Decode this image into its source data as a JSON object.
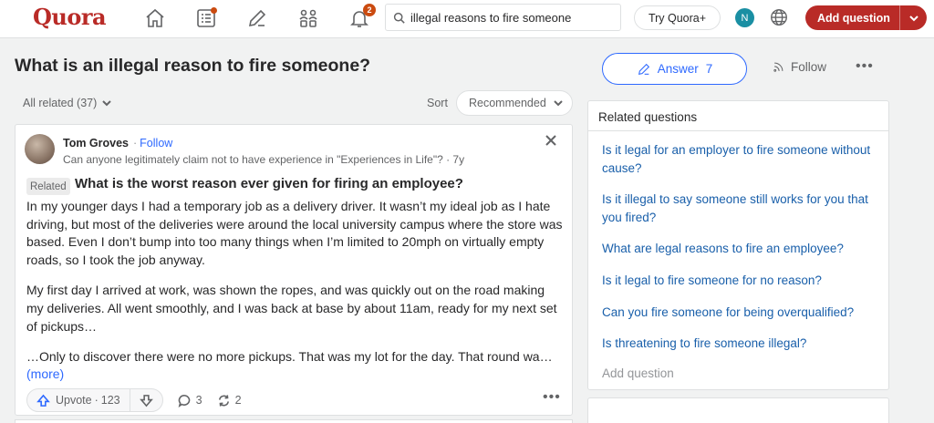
{
  "nav": {
    "logo": "Quora",
    "notifications_count": "2",
    "search_value": "illegal reasons to fire someone",
    "try_plus_label": "Try Quora+",
    "avatar_initial": "N",
    "add_question_label": "Add question",
    "icons": [
      "home-icon",
      "following-icon",
      "answer-icon",
      "spaces-icon",
      "notifications-icon",
      "search-icon",
      "globe-icon",
      "chevron-down-icon"
    ]
  },
  "question": {
    "title": "What is an illegal reason to fire someone?",
    "answer_label": "Answer",
    "answer_count": "7",
    "follow_label": "Follow",
    "more_label": "•••"
  },
  "filters": {
    "all_related_label": "All related (37)",
    "sort_label": "Sort",
    "sort_value": "Recommended"
  },
  "answer_card": {
    "author_name": "Tom Groves",
    "follow_label": "Follow",
    "credential": "Can anyone legitimately claim not to have experience in \"Experiences in Life\"? · 7y",
    "related_tag": "Related",
    "related_question": "What is the worst reason ever given for firing an employee?",
    "paragraphs": [
      "In my younger days I had a temporary job as a delivery driver. It wasn’t my ideal job as I hate driving, but most of the deliveries were around the local university campus where the store was based. Even I don’t bump into too many things when I’m limited to 20mph on virtually empty roads, so I took the job anyway.",
      "My first day I arrived at work, was shown the ropes, and was quickly out on the road making my deliveries. All went smoothly, and I was back at base by about 11am, ready for my next set of pickups…",
      "…Only to discover there were no more pickups. That was my lot for the day. That round wa…"
    ],
    "more_link": "(more)",
    "upvote_label": "Upvote",
    "upvote_count": "123",
    "comments_count": "3",
    "shares_count": "2",
    "more_label": "•••"
  },
  "related_questions": {
    "header": "Related questions",
    "items": [
      "Is it legal for an employer to fire someone without cause?",
      "Is it illegal to say someone still works for you that you fired?",
      "What are legal reasons to fire an employee?",
      "Is it legal to fire someone for no reason?",
      "Can you fire someone for being overqualified?",
      "Is threatening to fire someone illegal?"
    ],
    "add_question_label": "Add question"
  },
  "colors": {
    "brand": "#b92b27",
    "link": "#2e69ff",
    "related_link": "#195faa",
    "notification": "#cb4b10",
    "avatar": "#1a8fa3"
  }
}
